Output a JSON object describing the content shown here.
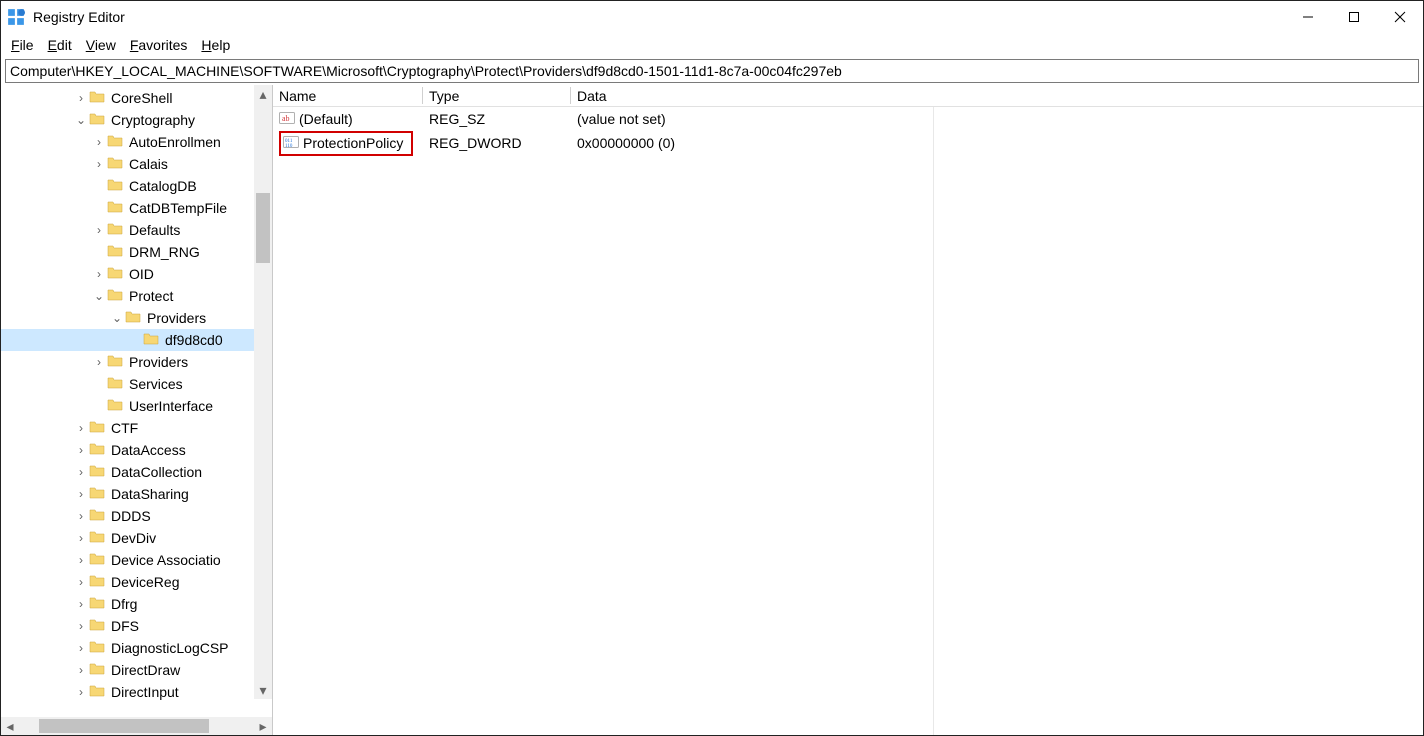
{
  "window": {
    "title": "Registry Editor"
  },
  "menu": {
    "file": "File",
    "edit": "Edit",
    "view": "View",
    "favorites": "Favorites",
    "help": "Help"
  },
  "address": "Computer\\HKEY_LOCAL_MACHINE\\SOFTWARE\\Microsoft\\Cryptography\\Protect\\Providers\\df9d8cd0-1501-11d1-8c7a-00c04fc297eb",
  "tree": [
    {
      "indent": 4,
      "exp": ">",
      "label": "CoreShell"
    },
    {
      "indent": 4,
      "exp": "v",
      "label": "Cryptography"
    },
    {
      "indent": 5,
      "exp": ">",
      "label": "AutoEnrollmen"
    },
    {
      "indent": 5,
      "exp": ">",
      "label": "Calais"
    },
    {
      "indent": 5,
      "exp": "",
      "label": "CatalogDB"
    },
    {
      "indent": 5,
      "exp": "",
      "label": "CatDBTempFile"
    },
    {
      "indent": 5,
      "exp": ">",
      "label": "Defaults"
    },
    {
      "indent": 5,
      "exp": "",
      "label": "DRM_RNG"
    },
    {
      "indent": 5,
      "exp": ">",
      "label": "OID"
    },
    {
      "indent": 5,
      "exp": "v",
      "label": "Protect"
    },
    {
      "indent": 6,
      "exp": "v",
      "label": "Providers"
    },
    {
      "indent": 7,
      "exp": "",
      "label": "df9d8cd0",
      "selected": true
    },
    {
      "indent": 5,
      "exp": ">",
      "label": "Providers"
    },
    {
      "indent": 5,
      "exp": "",
      "label": "Services"
    },
    {
      "indent": 5,
      "exp": "",
      "label": "UserInterface"
    },
    {
      "indent": 4,
      "exp": ">",
      "label": "CTF"
    },
    {
      "indent": 4,
      "exp": ">",
      "label": "DataAccess"
    },
    {
      "indent": 4,
      "exp": ">",
      "label": "DataCollection"
    },
    {
      "indent": 4,
      "exp": ">",
      "label": "DataSharing"
    },
    {
      "indent": 4,
      "exp": ">",
      "label": "DDDS"
    },
    {
      "indent": 4,
      "exp": ">",
      "label": "DevDiv"
    },
    {
      "indent": 4,
      "exp": ">",
      "label": "Device Associatio"
    },
    {
      "indent": 4,
      "exp": ">",
      "label": "DeviceReg"
    },
    {
      "indent": 4,
      "exp": ">",
      "label": "Dfrg"
    },
    {
      "indent": 4,
      "exp": ">",
      "label": "DFS"
    },
    {
      "indent": 4,
      "exp": ">",
      "label": "DiagnosticLogCSP"
    },
    {
      "indent": 4,
      "exp": ">",
      "label": "DirectDraw"
    },
    {
      "indent": 4,
      "exp": ">",
      "label": "DirectInput"
    }
  ],
  "columns": {
    "name": "Name",
    "type": "Type",
    "data": "Data"
  },
  "rows": [
    {
      "icon": "ab",
      "name": "(Default)",
      "type": "REG_SZ",
      "data": "(value not set)",
      "highlight": false
    },
    {
      "icon": "bin",
      "name": "ProtectionPolicy",
      "type": "REG_DWORD",
      "data": "0x00000000 (0)",
      "highlight": true
    }
  ]
}
